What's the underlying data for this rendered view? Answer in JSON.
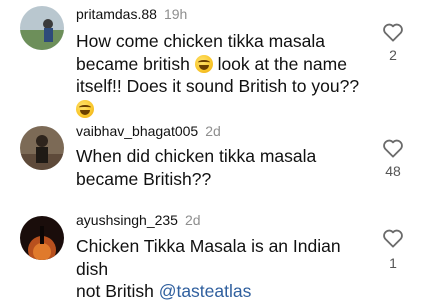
{
  "comments": [
    {
      "username": "pritamdas.88",
      "time": "19h",
      "text_parts": [
        "How come chicken tikka masala",
        "became british",
        "look at the name",
        "itself!! Does it sound British to you??"
      ],
      "emoji": "joy-emoji",
      "likes": "2"
    },
    {
      "username": "vaibhav_bhagat005",
      "time": "2d",
      "text_lines": [
        "When did chicken tikka masala",
        "became British??"
      ],
      "likes": "48"
    },
    {
      "username": "ayushsingh_235",
      "time": "2d",
      "text_line1": "Chicken Tikka Masala is an Indian dish",
      "text_line2": "not British",
      "mention": "@tasteatlas",
      "likes": "1"
    }
  ],
  "icons": {
    "like": "heart-outline-icon"
  },
  "colors": {
    "mention": "#2f5f9e",
    "secondary_text": "#8e8e8e"
  }
}
